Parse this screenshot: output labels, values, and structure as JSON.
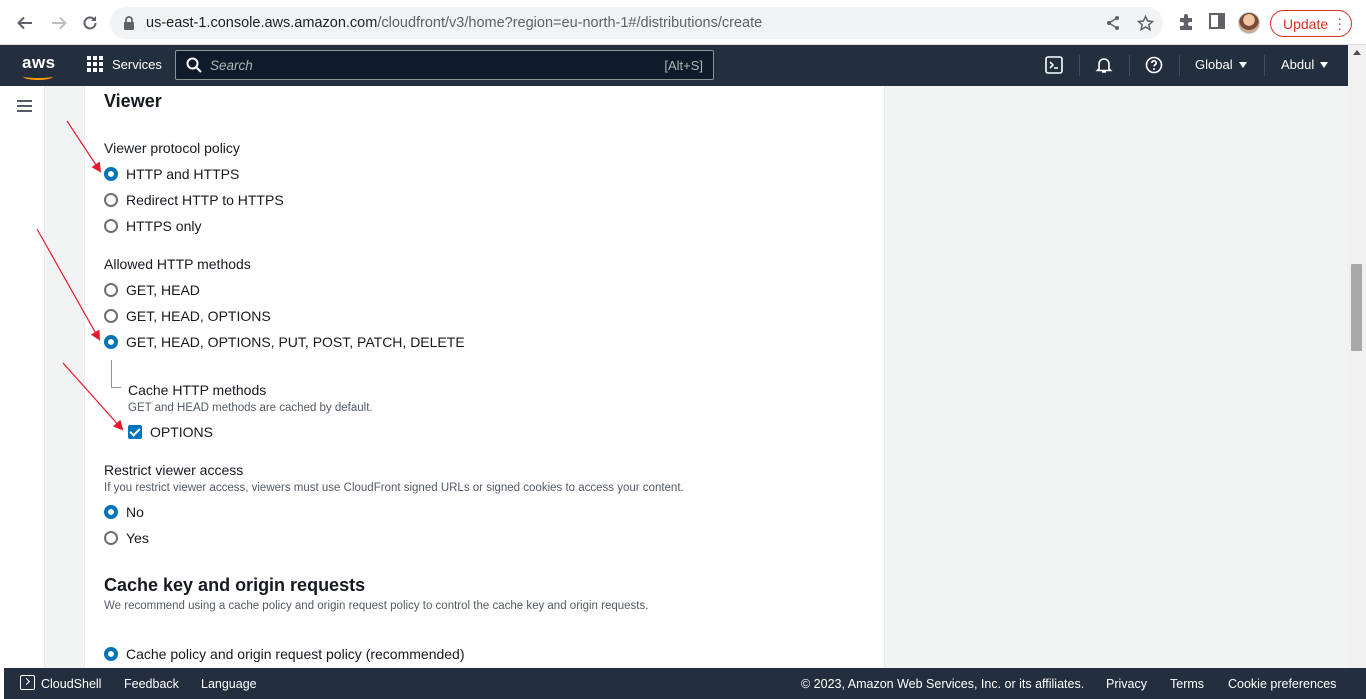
{
  "browser": {
    "url_host": "us-east-1.console.aws.amazon.com",
    "url_path": "/cloudfront/v3/home?region=eu-north-1#/distributions/create",
    "update_label": "Update"
  },
  "aws_header": {
    "logo": "aws",
    "services_label": "Services",
    "search_placeholder": "Search",
    "search_shortcut": "[Alt+S]",
    "region_label": "Global",
    "account_label": "Abdul"
  },
  "viewer": {
    "title": "Viewer",
    "protocol": {
      "label": "Viewer protocol policy",
      "options": [
        "HTTP and HTTPS",
        "Redirect HTTP to HTTPS",
        "HTTPS only"
      ],
      "selected": "HTTP and HTTPS"
    },
    "methods": {
      "label": "Allowed HTTP methods",
      "options": [
        "GET, HEAD",
        "GET, HEAD, OPTIONS",
        "GET, HEAD, OPTIONS, PUT, POST, PATCH, DELETE"
      ],
      "selected": "GET, HEAD, OPTIONS, PUT, POST, PATCH, DELETE"
    },
    "cache_methods": {
      "label": "Cache HTTP methods",
      "description": "GET and HEAD methods are cached by default.",
      "checkbox_label": "OPTIONS",
      "checked": true
    },
    "restrict": {
      "label": "Restrict viewer access",
      "description": "If you restrict viewer access, viewers must use CloudFront signed URLs or signed cookies to access your content.",
      "options": [
        "No",
        "Yes"
      ],
      "selected": "No"
    }
  },
  "cache_key": {
    "title": "Cache key and origin requests",
    "description": "We recommend using a cache policy and origin request policy to control the cache key and origin requests.",
    "option": "Cache policy and origin request policy (recommended)",
    "selected": true
  },
  "footer": {
    "cloudshell": "CloudShell",
    "feedback": "Feedback",
    "language": "Language",
    "copyright": "© 2023, Amazon Web Services, Inc. or its affiliates.",
    "privacy": "Privacy",
    "terms": "Terms",
    "cookies": "Cookie preferences"
  },
  "colors": {
    "aws_header": "#232f3e",
    "aws_orange": "#ff9900",
    "selected_blue": "#0073bb",
    "annotation_red": "#e8192c",
    "update_red": "#d93025"
  }
}
